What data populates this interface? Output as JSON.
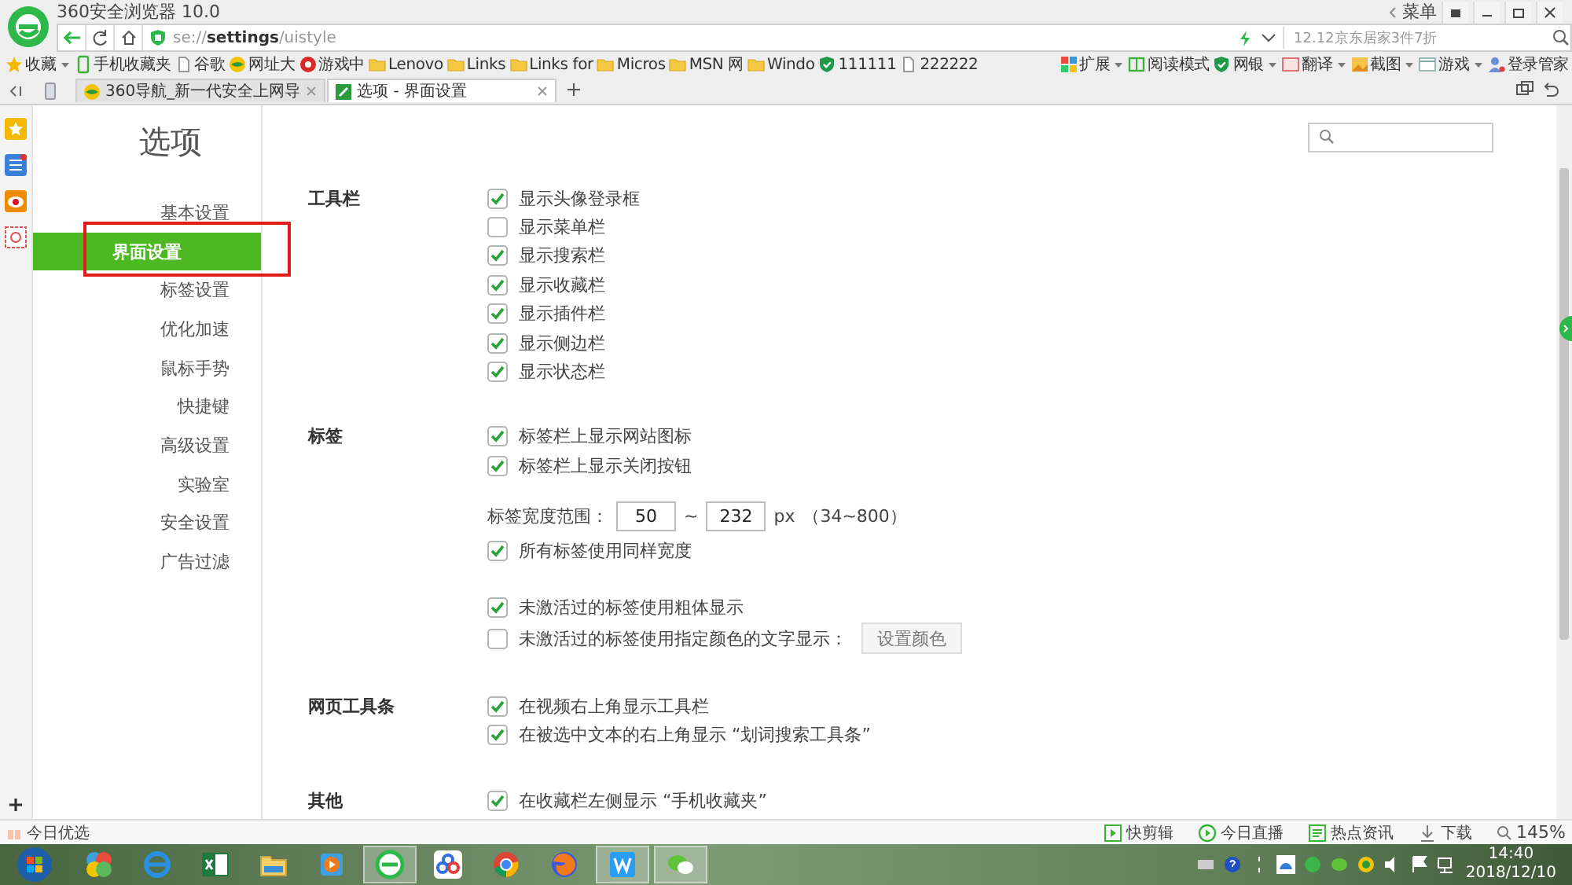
{
  "window": {
    "title": "360安全浏览器 10.0",
    "menu": "菜单"
  },
  "address_bar": {
    "url": "se://**settings**/uistyle",
    "search_placeholder": "12.12京东居家3件7折"
  },
  "bookmarks": [
    {
      "label": "收藏",
      "kind": "star",
      "dropdown": true
    },
    {
      "label": "手机收藏夹",
      "kind": "phone",
      "dropdown": false
    },
    {
      "label": "谷歌",
      "kind": "page",
      "dropdown": false
    },
    {
      "label": "网址大",
      "kind": "globe",
      "dropdown": false
    },
    {
      "label": "游戏中",
      "kind": "game",
      "dropdown": false
    },
    {
      "label": "Lenovo",
      "kind": "folder",
      "dropdown": false
    },
    {
      "label": "Links",
      "kind": "folder",
      "dropdown": false
    },
    {
      "label": "Links for",
      "kind": "folder",
      "dropdown": false
    },
    {
      "label": "Micros",
      "kind": "folder",
      "dropdown": false
    },
    {
      "label": "MSN 网",
      "kind": "folder",
      "dropdown": false
    },
    {
      "label": "Windo",
      "kind": "folder",
      "dropdown": false
    },
    {
      "label": "111111",
      "kind": "shield",
      "dropdown": false
    },
    {
      "label": "222222",
      "kind": "page",
      "dropdown": false
    }
  ],
  "extensions": [
    {
      "label": "扩展",
      "kind": "blocks",
      "dropdown": true
    },
    {
      "label": "阅读模式",
      "kind": "book",
      "dropdown": false
    },
    {
      "label": "网银",
      "kind": "shield",
      "dropdown": true
    },
    {
      "label": "翻译",
      "kind": "translate",
      "dropdown": true
    },
    {
      "label": "截图",
      "kind": "image",
      "dropdown": true
    },
    {
      "label": "游戏",
      "kind": "window",
      "dropdown": true
    },
    {
      "label": "登录管家",
      "kind": "user",
      "dropdown": false
    }
  ],
  "tabs": [
    {
      "label": "360导航_新一代安全上网导",
      "selected": false
    },
    {
      "label": "选项 - 界面设置",
      "selected": true
    }
  ],
  "settings": {
    "title": "选项",
    "nav": [
      {
        "label": "基本设置",
        "selected": false
      },
      {
        "label": "界面设置",
        "selected": true
      },
      {
        "label": "标签设置",
        "selected": false
      },
      {
        "label": "优化加速",
        "selected": false
      },
      {
        "label": "鼠标手势",
        "selected": false
      },
      {
        "label": "快捷键",
        "selected": false
      },
      {
        "label": "高级设置",
        "selected": false
      },
      {
        "label": "实验室",
        "selected": false
      },
      {
        "label": "安全设置",
        "selected": false
      },
      {
        "label": "广告过滤",
        "selected": false
      }
    ],
    "sections": [
      {
        "title": "工具栏",
        "rows": [
          {
            "kind": "checkbox",
            "label": "显示头像登录框",
            "checked": true
          },
          {
            "kind": "checkbox",
            "label": "显示菜单栏",
            "checked": false
          },
          {
            "kind": "checkbox",
            "label": "显示搜索栏",
            "checked": true
          },
          {
            "kind": "checkbox",
            "label": "显示收藏栏",
            "checked": true
          },
          {
            "kind": "checkbox",
            "label": "显示插件栏",
            "checked": true
          },
          {
            "kind": "checkbox",
            "label": "显示侧边栏",
            "checked": true
          },
          {
            "kind": "checkbox",
            "label": "显示状态栏",
            "checked": true
          }
        ]
      },
      {
        "title": "标签",
        "rows": [
          {
            "kind": "checkbox",
            "label": "标签栏上显示网站图标",
            "checked": true
          },
          {
            "kind": "checkbox",
            "label": "标签栏上显示关闭按钮",
            "checked": true
          },
          {
            "kind": "range",
            "label": "标签宽度范围：",
            "min": "50",
            "separator": "~",
            "max": "232",
            "unit": "px",
            "hint": "（34~800）"
          },
          {
            "kind": "checkbox",
            "label": "所有标签使用同样宽度",
            "checked": true
          },
          {
            "kind": "gap"
          },
          {
            "kind": "checkbox",
            "label": "未激活过的标签使用粗体显示",
            "checked": true
          },
          {
            "kind": "checkbox_button",
            "label": "未激活过的标签使用指定颜色的文字显示：",
            "checked": false,
            "button": "设置颜色"
          }
        ]
      },
      {
        "title": "网页工具条",
        "rows": [
          {
            "kind": "checkbox",
            "label": "在视频右上角显示工具栏",
            "checked": true
          },
          {
            "kind": "checkbox",
            "label": "在被选中文本的右上角显示 “划词搜索工具条”",
            "checked": true
          }
        ]
      },
      {
        "title": "其他",
        "rows": [
          {
            "kind": "checkbox",
            "label": "在收藏栏左侧显示 “手机收藏夹”",
            "checked": true
          }
        ]
      }
    ]
  },
  "status_bar": {
    "left": "今日优选",
    "items": [
      {
        "label": "快剪辑",
        "kind": "clip"
      },
      {
        "label": "今日直播",
        "kind": "play"
      },
      {
        "label": "热点资讯",
        "kind": "news"
      },
      {
        "label": "下载",
        "kind": "download"
      }
    ],
    "zoom": "145%"
  },
  "taskbar": {
    "apps": [
      {
        "kind": "pinwheel",
        "running": false
      },
      {
        "kind": "ie",
        "running": false
      },
      {
        "kind": "sheet",
        "running": false
      },
      {
        "kind": "folder",
        "running": false
      },
      {
        "kind": "media",
        "running": false
      },
      {
        "kind": "browser",
        "running": true
      },
      {
        "kind": "cloud",
        "running": false
      },
      {
        "kind": "chrome",
        "running": false
      },
      {
        "kind": "fox",
        "running": false
      },
      {
        "kind": "writer",
        "running": true
      },
      {
        "kind": "chat",
        "running": true
      }
    ],
    "time": "14:40",
    "date": "2018/12/10"
  }
}
